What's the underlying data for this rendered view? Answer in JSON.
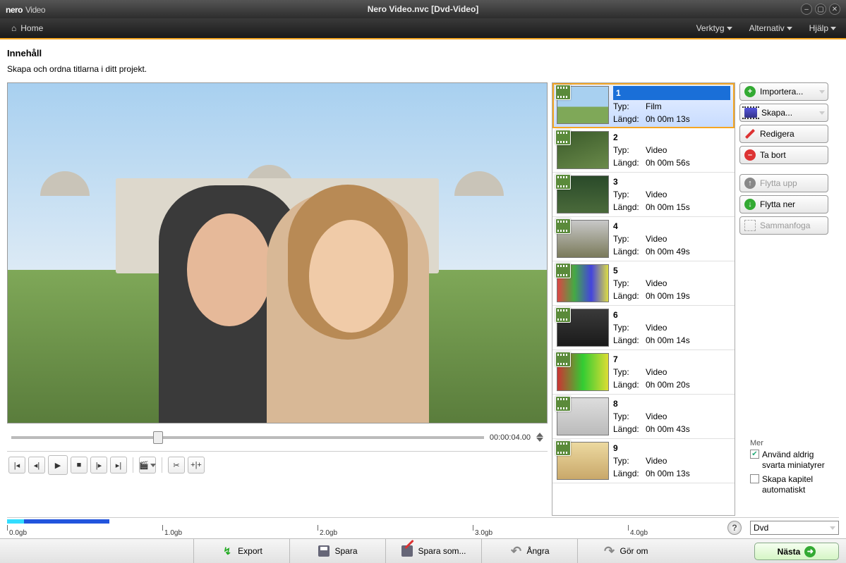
{
  "titlebar": {
    "brand": "nero",
    "product": "Video",
    "document": "Nero Video.nvc [Dvd-Video]"
  },
  "navbar": {
    "home": "Home",
    "tools": "Verktyg",
    "options": "Alternativ",
    "help": "Hjälp"
  },
  "header": {
    "title": "Innehåll",
    "subtitle": "Skapa och ordna titlarna i ditt projekt."
  },
  "timecode": "00:00:04.00",
  "clips": [
    {
      "num": "1",
      "type_label": "Typ:",
      "type": "Film",
      "len_label": "Längd:",
      "len": "0h 00m 13s",
      "thumb": "t1",
      "selected": true
    },
    {
      "num": "2",
      "type_label": "Typ:",
      "type": "Video",
      "len_label": "Längd:",
      "len": "0h 00m 56s",
      "thumb": "t2"
    },
    {
      "num": "3",
      "type_label": "Typ:",
      "type": "Video",
      "len_label": "Längd:",
      "len": "0h 00m 15s",
      "thumb": "t3"
    },
    {
      "num": "4",
      "type_label": "Typ:",
      "type": "Video",
      "len_label": "Längd:",
      "len": "0h 00m 49s",
      "thumb": "t4"
    },
    {
      "num": "5",
      "type_label": "Typ:",
      "type": "Video",
      "len_label": "Längd:",
      "len": "0h 00m 19s",
      "thumb": "t5"
    },
    {
      "num": "6",
      "type_label": "Typ:",
      "type": "Video",
      "len_label": "Längd:",
      "len": "0h 00m 14s",
      "thumb": "t6"
    },
    {
      "num": "7",
      "type_label": "Typ:",
      "type": "Video",
      "len_label": "Längd:",
      "len": "0h 00m 20s",
      "thumb": "t7"
    },
    {
      "num": "8",
      "type_label": "Typ:",
      "type": "Video",
      "len_label": "Längd:",
      "len": "0h 00m 43s",
      "thumb": "t8"
    },
    {
      "num": "9",
      "type_label": "Typ:",
      "type": "Video",
      "len_label": "Längd:",
      "len": "0h 00m 13s",
      "thumb": "t9"
    }
  ],
  "actions": {
    "import": "Importera...",
    "create": "Skapa...",
    "edit": "Redigera",
    "delete": "Ta bort",
    "moveup": "Flytta upp",
    "movedown": "Flytta ner",
    "merge": "Sammanfoga"
  },
  "more": {
    "header": "Mer",
    "opt1": "Använd aldrig svarta miniatyrer",
    "opt2": "Skapa kapitel automatiskt",
    "opt1_checked": true,
    "opt2_checked": false
  },
  "ruler": {
    "ticks": [
      "0.0gb",
      "1.0gb",
      "2.0gb",
      "3.0gb",
      "4.0gb"
    ],
    "disc": "Dvd"
  },
  "bottom": {
    "export": "Export",
    "save": "Spara",
    "saveas": "Spara som...",
    "undo": "Ångra",
    "redo": "Gör om",
    "next": "Nästa"
  }
}
